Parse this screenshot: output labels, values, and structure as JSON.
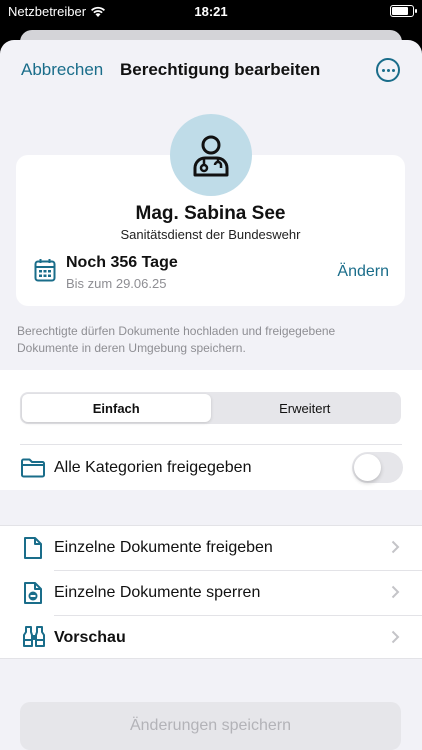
{
  "status_bar": {
    "carrier": "Netzbetreiber",
    "time": "18:21",
    "battery_level": 0.9
  },
  "nav": {
    "cancel_label": "Abbrechen",
    "title": "Berechtigung bearbeiten",
    "more_icon": "ellipsis-circle-icon"
  },
  "person": {
    "avatar_icon": "doctor-icon",
    "name": "Mag. Sabina See",
    "organization": "Sanitätsdienst der Bundeswehr",
    "duration": "Noch 356 Tage",
    "until": "Bis zum 29.06.25",
    "change_label": "Ändern"
  },
  "info_text": "Berechtigte dürfen Dokumente hochladen und freigegebene Dokumente in deren Umgebung speichern.",
  "segments": [
    {
      "label": "Einfach",
      "active": true
    },
    {
      "label": "Erweitert",
      "active": false
    }
  ],
  "categories": {
    "label": "Alle Kategorien freigegeben",
    "enabled": false
  },
  "list": [
    {
      "label": "Einzelne Dokumente freigeben",
      "icon": "document-icon"
    },
    {
      "label": "Einzelne Dokumente sperren",
      "icon": "document-blocked-icon"
    },
    {
      "label": "Vorschau",
      "icon": "binoculars-icon"
    }
  ],
  "save_label": "Änderungen speichern",
  "colors": {
    "accent": "#1a6d8a",
    "avatar_bg": "#bfdce8",
    "background": "#f2f2f7"
  }
}
